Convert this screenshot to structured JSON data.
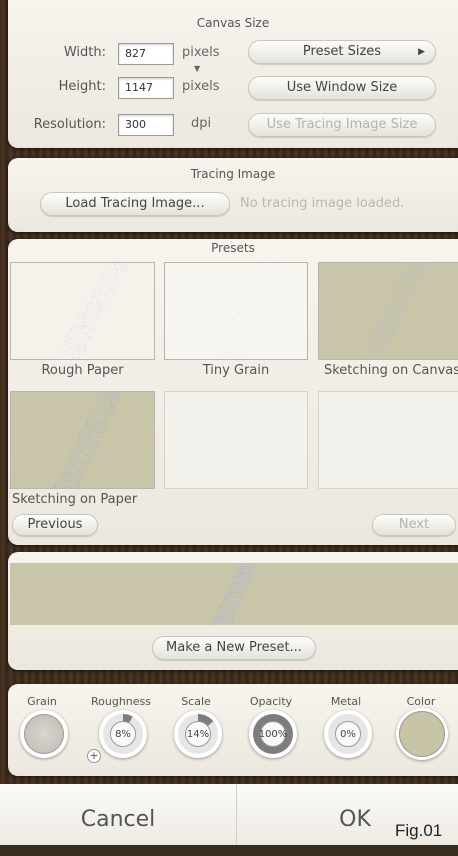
{
  "canvas_size": {
    "title": "Canvas Size",
    "width_label": "Width:",
    "width_value": "827",
    "width_unit": "pixels",
    "height_label": "Height:",
    "height_value": "1147",
    "height_unit": "pixels",
    "resolution_label": "Resolution:",
    "resolution_value": "300",
    "resolution_unit": "dpi",
    "preset_sizes_label": "Preset Sizes",
    "use_window_size_label": "Use Window Size",
    "use_tracing_image_size_label": "Use Tracing Image Size"
  },
  "tracing_image": {
    "title": "Tracing Image",
    "load_button_label": "Load Tracing Image...",
    "status_text": "No tracing image loaded."
  },
  "presets": {
    "title": "Presets",
    "items": [
      {
        "label": "Rough Paper"
      },
      {
        "label": "Tiny Grain"
      },
      {
        "label": "Sketching on Canvas"
      },
      {
        "label": "Sketching on Paper"
      },
      {
        "label": ""
      },
      {
        "label": ""
      }
    ],
    "previous_label": "Previous",
    "next_label": "Next",
    "make_new_preset_label": "Make a New Preset..."
  },
  "settings": {
    "grain_label": "Grain",
    "roughness_label": "Roughness",
    "roughness_value": "8%",
    "scale_label": "Scale",
    "scale_value": "14%",
    "opacity_label": "Opacity",
    "opacity_value": "100%",
    "metal_label": "Metal",
    "metal_value": "0%",
    "color_label": "Color",
    "color_value": "#c8c4a6",
    "add_grain_symbol": "+"
  },
  "footer": {
    "cancel_label": "Cancel",
    "ok_label": "OK",
    "fig_label": "Fig.01"
  }
}
